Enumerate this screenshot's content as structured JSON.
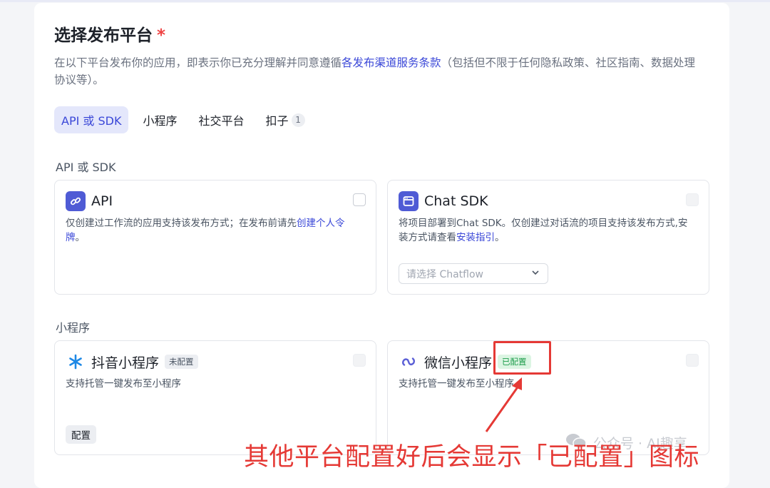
{
  "header": {
    "title": "选择发布平台",
    "required_mark": "*",
    "description_before": "在以下平台发布你的应用，即表示你已充分理解并同意遵循",
    "description_link": "各发布渠道服务条款",
    "description_after": "（包括但不限于任何隐私政策、社区指南、数据处理协议等）。"
  },
  "tabs": [
    {
      "label": "API 或 SDK",
      "active": true
    },
    {
      "label": "小程序"
    },
    {
      "label": "社交平台"
    },
    {
      "label": "扣子",
      "count": "1"
    }
  ],
  "sections": {
    "api_sdk": {
      "label": "API 或 SDK",
      "api": {
        "name": "API",
        "desc_before": "仅创建过工作流的应用支持该发布方式；在发布前请先",
        "desc_link": "创建个人令牌",
        "desc_after": "。"
      },
      "chat_sdk": {
        "name": "Chat SDK",
        "desc_before": "将项目部署到Chat SDK。仅创建过对话流的项目支持该发布方式,安装方式请查看",
        "desc_link": "安装指引",
        "desc_after": "。",
        "select_placeholder": "请选择 Chatflow"
      }
    },
    "mini_program": {
      "label": "小程序",
      "douyin": {
        "name": "抖音小程序",
        "badge": "未配置",
        "desc": "支持托管一键发布至小程序",
        "config_button": "配置"
      },
      "wechat": {
        "name": "微信小程序",
        "badge": "已配置",
        "desc": "支持托管一键发布至小程序"
      }
    }
  },
  "overlay": {
    "watermark": "公众号 · AI趣享",
    "annotation": "其他平台配置好后会显示「已配置」图标",
    "highlight_color": "#e53935"
  },
  "colors": {
    "accent": "#3b48d8",
    "success": "#1f9d4c"
  }
}
